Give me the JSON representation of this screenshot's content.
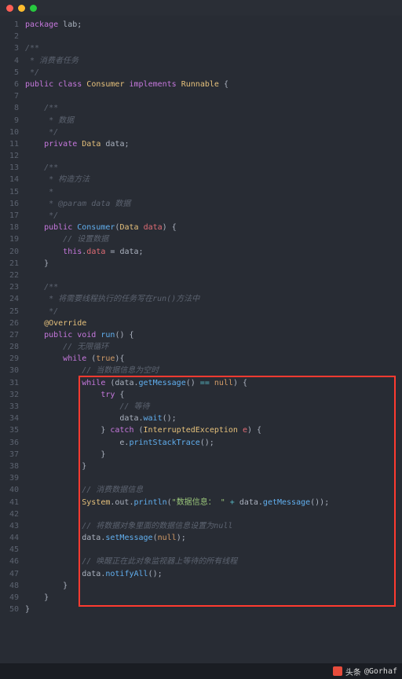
{
  "footer": {
    "brand_prefix": "头条",
    "handle": "@Gorhaf"
  },
  "code": {
    "lines": [
      {
        "n": 1,
        "seg": [
          {
            "c": "k",
            "t": "package"
          },
          {
            "c": "p",
            "t": " lab;"
          }
        ]
      },
      {
        "n": 2,
        "seg": []
      },
      {
        "n": 3,
        "seg": [
          {
            "c": "c",
            "t": "/**"
          }
        ]
      },
      {
        "n": 4,
        "seg": [
          {
            "c": "c",
            "t": " * 消费者任务"
          }
        ]
      },
      {
        "n": 5,
        "seg": [
          {
            "c": "c",
            "t": " */"
          }
        ]
      },
      {
        "n": 6,
        "seg": [
          {
            "c": "k",
            "t": "public"
          },
          {
            "c": "p",
            "t": " "
          },
          {
            "c": "k",
            "t": "class"
          },
          {
            "c": "p",
            "t": " "
          },
          {
            "c": "t",
            "t": "Consumer"
          },
          {
            "c": "p",
            "t": " "
          },
          {
            "c": "k",
            "t": "implements"
          },
          {
            "c": "p",
            "t": " "
          },
          {
            "c": "t",
            "t": "Runnable"
          },
          {
            "c": "p",
            "t": " {"
          }
        ]
      },
      {
        "n": 7,
        "seg": []
      },
      {
        "n": 8,
        "seg": [
          {
            "c": "c",
            "t": "    /**"
          }
        ]
      },
      {
        "n": 9,
        "seg": [
          {
            "c": "c",
            "t": "     * 数据"
          }
        ]
      },
      {
        "n": 10,
        "seg": [
          {
            "c": "c",
            "t": "     */"
          }
        ]
      },
      {
        "n": 11,
        "seg": [
          {
            "c": "p",
            "t": "    "
          },
          {
            "c": "k",
            "t": "private"
          },
          {
            "c": "p",
            "t": " "
          },
          {
            "c": "t",
            "t": "Data"
          },
          {
            "c": "p",
            "t": " data;"
          }
        ]
      },
      {
        "n": 12,
        "seg": []
      },
      {
        "n": 13,
        "seg": [
          {
            "c": "c",
            "t": "    /**"
          }
        ]
      },
      {
        "n": 14,
        "seg": [
          {
            "c": "c",
            "t": "     * 构造方法"
          }
        ]
      },
      {
        "n": 15,
        "seg": [
          {
            "c": "c",
            "t": "     *"
          }
        ]
      },
      {
        "n": 16,
        "seg": [
          {
            "c": "c",
            "t": "     * @param data 数据"
          }
        ]
      },
      {
        "n": 17,
        "seg": [
          {
            "c": "c",
            "t": "     */"
          }
        ]
      },
      {
        "n": 18,
        "seg": [
          {
            "c": "p",
            "t": "    "
          },
          {
            "c": "k",
            "t": "public"
          },
          {
            "c": "p",
            "t": " "
          },
          {
            "c": "m",
            "t": "Consumer"
          },
          {
            "c": "p",
            "t": "("
          },
          {
            "c": "t",
            "t": "Data"
          },
          {
            "c": "p",
            "t": " "
          },
          {
            "c": "v",
            "t": "data"
          },
          {
            "c": "p",
            "t": ") {"
          }
        ]
      },
      {
        "n": 19,
        "seg": [
          {
            "c": "c",
            "t": "        // 设置数据"
          }
        ]
      },
      {
        "n": 20,
        "seg": [
          {
            "c": "p",
            "t": "        "
          },
          {
            "c": "k",
            "t": "this"
          },
          {
            "c": "p",
            "t": "."
          },
          {
            "c": "v",
            "t": "data"
          },
          {
            "c": "p",
            "t": " = data;"
          }
        ]
      },
      {
        "n": 21,
        "seg": [
          {
            "c": "p",
            "t": "    }"
          }
        ]
      },
      {
        "n": 22,
        "seg": []
      },
      {
        "n": 23,
        "seg": [
          {
            "c": "c",
            "t": "    /**"
          }
        ]
      },
      {
        "n": 24,
        "seg": [
          {
            "c": "c",
            "t": "     * 将需要线程执行的任务写在run()方法中"
          }
        ]
      },
      {
        "n": 25,
        "seg": [
          {
            "c": "c",
            "t": "     */"
          }
        ]
      },
      {
        "n": 26,
        "seg": [
          {
            "c": "p",
            "t": "    "
          },
          {
            "c": "a",
            "t": "@Override"
          }
        ]
      },
      {
        "n": 27,
        "seg": [
          {
            "c": "p",
            "t": "    "
          },
          {
            "c": "k",
            "t": "public"
          },
          {
            "c": "p",
            "t": " "
          },
          {
            "c": "k",
            "t": "void"
          },
          {
            "c": "p",
            "t": " "
          },
          {
            "c": "m",
            "t": "run"
          },
          {
            "c": "p",
            "t": "() {"
          }
        ]
      },
      {
        "n": 28,
        "seg": [
          {
            "c": "c",
            "t": "        // 无限循环"
          }
        ]
      },
      {
        "n": 29,
        "seg": [
          {
            "c": "p",
            "t": "        "
          },
          {
            "c": "k",
            "t": "while"
          },
          {
            "c": "p",
            "t": " ("
          },
          {
            "c": "d",
            "t": "true"
          },
          {
            "c": "p",
            "t": "){"
          }
        ]
      },
      {
        "n": 30,
        "seg": [
          {
            "c": "c",
            "t": "            // 当数据信息为空时"
          }
        ]
      },
      {
        "n": 31,
        "seg": [
          {
            "c": "p",
            "t": "            "
          },
          {
            "c": "k",
            "t": "while"
          },
          {
            "c": "p",
            "t": " (data."
          },
          {
            "c": "m",
            "t": "getMessage"
          },
          {
            "c": "p",
            "t": "() "
          },
          {
            "c": "o",
            "t": "=="
          },
          {
            "c": "p",
            "t": " "
          },
          {
            "c": "d",
            "t": "null"
          },
          {
            "c": "p",
            "t": ") {"
          }
        ]
      },
      {
        "n": 32,
        "seg": [
          {
            "c": "p",
            "t": "                "
          },
          {
            "c": "k",
            "t": "try"
          },
          {
            "c": "p",
            "t": " {"
          }
        ]
      },
      {
        "n": 33,
        "seg": [
          {
            "c": "c",
            "t": "                    // 等待"
          }
        ]
      },
      {
        "n": 34,
        "seg": [
          {
            "c": "p",
            "t": "                    data."
          },
          {
            "c": "m",
            "t": "wait"
          },
          {
            "c": "p",
            "t": "();"
          }
        ]
      },
      {
        "n": 35,
        "seg": [
          {
            "c": "p",
            "t": "                } "
          },
          {
            "c": "k",
            "t": "catch"
          },
          {
            "c": "p",
            "t": " ("
          },
          {
            "c": "t",
            "t": "InterruptedException"
          },
          {
            "c": "p",
            "t": " "
          },
          {
            "c": "v",
            "t": "e"
          },
          {
            "c": "p",
            "t": ") {"
          }
        ]
      },
      {
        "n": 36,
        "seg": [
          {
            "c": "p",
            "t": "                    e."
          },
          {
            "c": "m",
            "t": "printStackTrace"
          },
          {
            "c": "p",
            "t": "();"
          }
        ]
      },
      {
        "n": 37,
        "seg": [
          {
            "c": "p",
            "t": "                }"
          }
        ]
      },
      {
        "n": 38,
        "seg": [
          {
            "c": "p",
            "t": "            }"
          }
        ]
      },
      {
        "n": 39,
        "seg": []
      },
      {
        "n": 40,
        "seg": [
          {
            "c": "c",
            "t": "            // 消费数据信息"
          }
        ]
      },
      {
        "n": 41,
        "seg": [
          {
            "c": "p",
            "t": "            "
          },
          {
            "c": "t",
            "t": "System"
          },
          {
            "c": "p",
            "t": ".out."
          },
          {
            "c": "m",
            "t": "println"
          },
          {
            "c": "p",
            "t": "("
          },
          {
            "c": "s",
            "t": "\"数据信息： \""
          },
          {
            "c": "p",
            "t": " "
          },
          {
            "c": "o",
            "t": "+"
          },
          {
            "c": "p",
            "t": " data."
          },
          {
            "c": "m",
            "t": "getMessage"
          },
          {
            "c": "p",
            "t": "());"
          }
        ]
      },
      {
        "n": 42,
        "seg": []
      },
      {
        "n": 43,
        "seg": [
          {
            "c": "c",
            "t": "            // 将数据对象里面的数据信息设置为null"
          }
        ]
      },
      {
        "n": 44,
        "seg": [
          {
            "c": "p",
            "t": "            data."
          },
          {
            "c": "m",
            "t": "setMessage"
          },
          {
            "c": "p",
            "t": "("
          },
          {
            "c": "d",
            "t": "null"
          },
          {
            "c": "p",
            "t": ");"
          }
        ]
      },
      {
        "n": 45,
        "seg": []
      },
      {
        "n": 46,
        "seg": [
          {
            "c": "c",
            "t": "            // 唤醒正在此对象监视器上等待的所有线程"
          }
        ]
      },
      {
        "n": 47,
        "seg": [
          {
            "c": "p",
            "t": "            data."
          },
          {
            "c": "m",
            "t": "notifyAll"
          },
          {
            "c": "p",
            "t": "();"
          }
        ]
      },
      {
        "n": 48,
        "seg": [
          {
            "c": "p",
            "t": "        }"
          }
        ]
      },
      {
        "n": 49,
        "seg": [
          {
            "c": "p",
            "t": "    }"
          }
        ]
      },
      {
        "n": 50,
        "seg": [
          {
            "c": "p",
            "t": "}"
          }
        ]
      }
    ]
  }
}
